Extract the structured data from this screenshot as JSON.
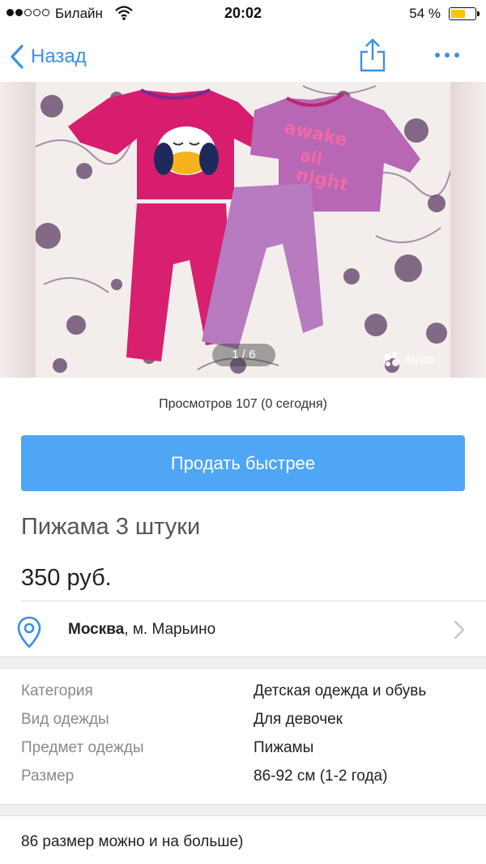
{
  "status_bar": {
    "carrier": "Билайн",
    "time": "20:02",
    "battery_percent": "54 %",
    "battery_level": 0.54,
    "signal_bars": 2
  },
  "nav": {
    "back_label": "Назад"
  },
  "gallery": {
    "counter": "1 / 6",
    "watermark": "Avito"
  },
  "views_text": "Просмотров 107 (0 сегодня)",
  "sell_button_label": "Продать быстрее",
  "listing": {
    "title": "Пижама 3 штуки",
    "price": "350 руб."
  },
  "location": {
    "city": "Москва",
    "metro": ", м. Марьино"
  },
  "params": [
    {
      "key": "Категория",
      "value": "Детская одежда и обувь"
    },
    {
      "key": "Вид одежды",
      "value": "Для девочек"
    },
    {
      "key": "Предмет одежды",
      "value": "Пижамы"
    },
    {
      "key": "Размер",
      "value": "86-92 см (1-2 года)"
    }
  ],
  "description": "86 размер можно и на больше)",
  "colors": {
    "accent": "#3d8fe6",
    "button": "#4ea6f4"
  },
  "icons": {
    "back": "chevron-left-icon",
    "share": "share-icon",
    "more": "more-icon",
    "location": "location-pin-icon",
    "chevron": "chevron-right-icon"
  }
}
